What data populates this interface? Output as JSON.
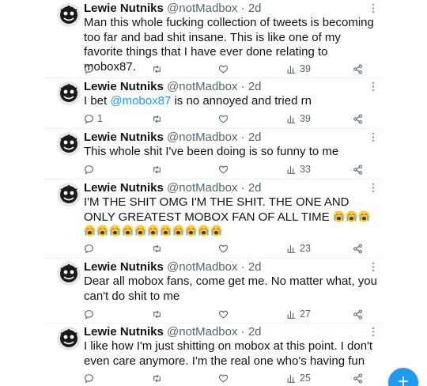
{
  "author": {
    "name": "Lewie Nutniks",
    "handle": "@notMadbox",
    "separator": "·"
  },
  "tweets": [
    {
      "time": "2d",
      "text": "Man this whole fucking collection of tweets is becoming too far and bad shit insane. This is like one of my favorite things that I have ever done relating to mobox87.",
      "replies": "",
      "views": "39"
    },
    {
      "time": "2d",
      "text_before": "I bet ",
      "mention": "@mobox87",
      "text_after": " is no annoyed and tried rn",
      "replies": "1",
      "views": "39"
    },
    {
      "time": "2d",
      "text": "This whole shit I've been doing is so funny to me",
      "replies": "",
      "views": "33"
    },
    {
      "time": "2d",
      "text": "I'M THE SHIT OMG I'M THE SHIT. THE ONE AND ONLY GREATEST MOBOX FAN OF ALL TIME ",
      "emoji_count": 14,
      "emoji_name": "loudly-crying-face",
      "replies": "",
      "views": "23"
    },
    {
      "time": "2d",
      "text": "Dear all mobox fans, come get me. No matter what, you can't do shit to me",
      "replies": "",
      "views": "27"
    },
    {
      "time": "2d",
      "text": "I like how I'm just shitting on mobox at this point. I don't even care anymore. I'm the real one who's having fun",
      "replies": "",
      "views": "25"
    }
  ],
  "icons": {
    "reply": "reply-icon",
    "retweet": "retweet-icon",
    "like": "like-icon",
    "views": "views-icon",
    "share": "share-icon",
    "more": "more-icon",
    "compose": "compose-icon"
  },
  "fab": {
    "label": "+"
  },
  "colors": {
    "accent": "#1d9bf0",
    "text": "#0f1419",
    "secondary": "#536471",
    "divider": "#eff3f4"
  }
}
